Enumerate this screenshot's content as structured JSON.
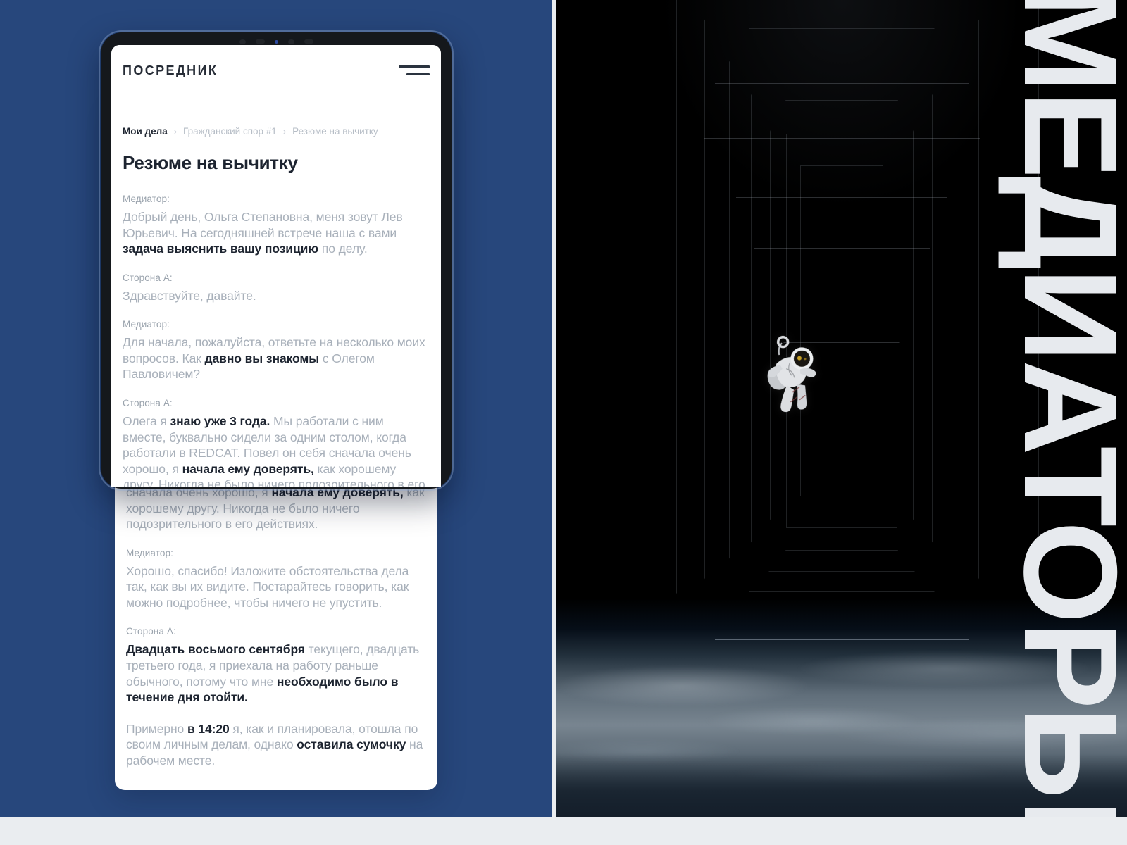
{
  "colors": {
    "navy_background": "#27477c",
    "page_surface": "#ffffff",
    "bottom_strip": "#eaedf0",
    "text_muted": "#a8b0ba",
    "text_strong": "#1d2430",
    "breadcrumb_muted": "#b6bdc6",
    "space_panel": "#000000",
    "vertical_title": "#e7eaee"
  },
  "app": {
    "logo": "ПОСРЕДНИК",
    "menu_icon": "hamburger-icon"
  },
  "breadcrumb": {
    "items": [
      {
        "label": "Мои дела",
        "active": true
      },
      {
        "label": "Гражданский спор #1",
        "active": false
      },
      {
        "label": "Резюме на вычитку",
        "active": false
      }
    ],
    "separator": "›"
  },
  "page": {
    "title": "Резюме на вычитку"
  },
  "speakers": {
    "mediator": "Медиатор:",
    "side_a": "Сторона А:"
  },
  "transcript": [
    {
      "speaker": "Медиатор:",
      "segments": [
        {
          "text": "Добрый день, Ольга Степановна, меня зовут Лев Юрьевич. На сегодняшней встрече наша с вами ",
          "bold": false
        },
        {
          "text": "задача выяснить вашу позицию",
          "bold": true
        },
        {
          "text": " по делу.",
          "bold": false
        }
      ]
    },
    {
      "speaker": "Сторона А:",
      "segments": [
        {
          "text": "Здравствуйте, давайте.",
          "bold": false
        }
      ]
    },
    {
      "speaker": "Медиатор:",
      "segments": [
        {
          "text": "Для начала, пожалуйста, ответьте на несколько моих вопросов. Как ",
          "bold": false
        },
        {
          "text": "давно вы знакомы",
          "bold": true
        },
        {
          "text": " с Олегом Павловичем?",
          "bold": false
        }
      ]
    },
    {
      "speaker": "Сторона А:",
      "segments": [
        {
          "text": "Олега я ",
          "bold": false
        },
        {
          "text": "знаю уже 3 года.",
          "bold": true
        },
        {
          "text": " Мы работали с ним вместе, буквально сидели за одним столом, когда работали в REDCAT. Повел он себя сначала очень хорошо, я ",
          "bold": false
        },
        {
          "text": "начала ему доверять,",
          "bold": true
        },
        {
          "text": " как хорошему другу. Никогда не было ничего подозрительного в его действиях.",
          "bold": false
        }
      ]
    },
    {
      "speaker": "Медиатор:",
      "segments": [
        {
          "text": "Хорошо, спасибо! Изложите обстоятельства дела так, как вы их видите. Постарайтесь говорить, как можно подробнее, чтобы ничего не упустить.",
          "bold": false
        }
      ]
    },
    {
      "speaker": "Сторона А:",
      "segments": [
        {
          "text": "Двадцать восьмого сентября",
          "bold": true
        },
        {
          "text": " текущего, двадцать третьего года, я приехала на работу раньше обычного, потому что мне ",
          "bold": false
        },
        {
          "text": "необходимо было в течение дня отойти.",
          "bold": true
        }
      ]
    },
    {
      "speaker": "",
      "segments": [
        {
          "text": "Примерно ",
          "bold": false
        },
        {
          "text": "в 14:20",
          "bold": true
        },
        {
          "text": " я, как и планировала, отошла по своим личным делам, однако ",
          "bold": false
        },
        {
          "text": "оставила сумочку",
          "bold": true
        },
        {
          "text": " на рабочем месте.",
          "bold": false
        }
      ]
    }
  ],
  "hero": {
    "vertical_title": "МЕДИАТОРЫ",
    "scene": "astronaut-floating-in-space-corridor-above-earth"
  }
}
